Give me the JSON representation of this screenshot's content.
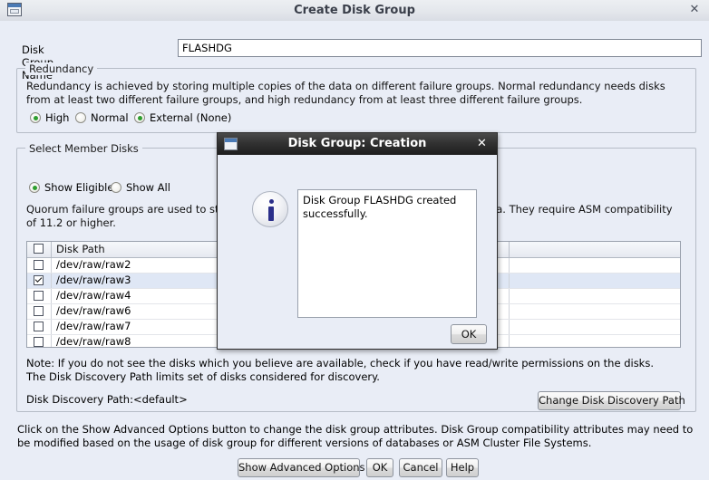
{
  "window": {
    "title": "Create Disk Group",
    "icon": "window-icon",
    "close_label": "✕"
  },
  "form": {
    "disk_group_name_label": "Disk Group Name",
    "disk_group_name_value": "FLASHDG",
    "disk_group_name_placeholder": ""
  },
  "redundancy": {
    "legend": "Redundancy",
    "description": "Redundancy is achieved by storing multiple copies of the data on different failure groups. Normal redundancy needs disks from at least two different failure groups, and high redundancy from at least three different failure groups.",
    "options": [
      {
        "label": "High",
        "selected": false
      },
      {
        "label": "Normal",
        "selected": false
      },
      {
        "label": "External (None)",
        "selected": true
      }
    ]
  },
  "members": {
    "legend": "Select Member Disks",
    "filters": [
      {
        "label": "Show Eligible",
        "selected": true
      },
      {
        "label": "Show All",
        "selected": false
      }
    ],
    "quorum_note": "Quorum failure groups are used to store voting files and they cannot contain any user data. They require ASM compatibility of 11.2 or higher.",
    "table": {
      "columns": [
        "",
        "Disk Path",
        ""
      ],
      "header_checkbox_checked": false,
      "rows": [
        {
          "checked": false,
          "path": "/dev/raw/raw2",
          "selected": false
        },
        {
          "checked": true,
          "path": "/dev/raw/raw3",
          "selected": true
        },
        {
          "checked": false,
          "path": "/dev/raw/raw4",
          "selected": false
        },
        {
          "checked": false,
          "path": "/dev/raw/raw6",
          "selected": false
        },
        {
          "checked": false,
          "path": "/dev/raw/raw7",
          "selected": false
        },
        {
          "checked": false,
          "path": "/dev/raw/raw8",
          "selected": false
        }
      ]
    },
    "note_line1": "Note: If you do not see the disks which you believe are available, check if you have read/write permissions on the disks.",
    "note_line2": "The Disk Discovery Path limits set of disks considered for discovery.",
    "discovery_path_label": "Disk Discovery Path:<default>",
    "change_discovery_path_button": "Change Disk Discovery Path"
  },
  "footer": {
    "hint": "Click on the Show Advanced Options button to change the disk group attributes. Disk Group compatibility attributes may need to be modified based on the usage of disk group for different versions of databases or ASM Cluster File Systems.",
    "buttons": {
      "advanced": "Show Advanced Options",
      "ok": "OK",
      "cancel": "Cancel",
      "help": "Help"
    }
  },
  "dialog": {
    "title": "Disk Group: Creation",
    "close_label": "✕",
    "icon": "info-icon",
    "message": "Disk Group FLASHDG created successfully.",
    "ok_label": "OK"
  },
  "colors": {
    "window_bg": "#e9edf6",
    "dialog_titlebar": "#232323",
    "radio_selected": "#2e9e2e",
    "row_selected": "#dfe7f5",
    "info_blue": "#2b2f8a"
  }
}
